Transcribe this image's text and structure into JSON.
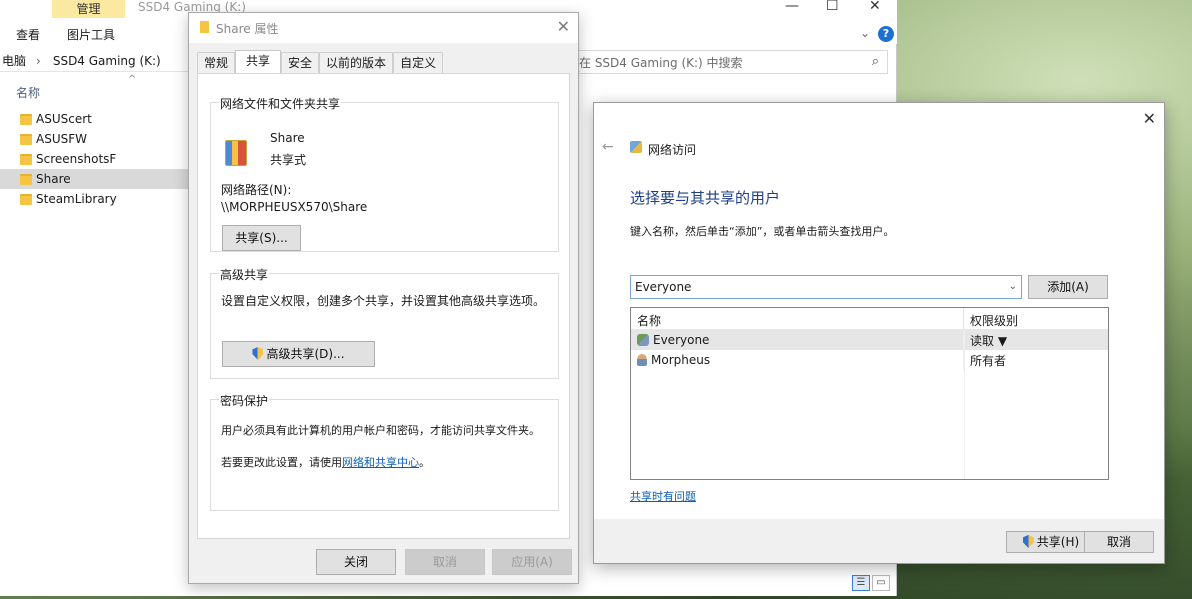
{
  "explorer": {
    "ribbon": {
      "context_tab": "管理",
      "window_title": "SSD4 Gaming (K:)",
      "tab_view": "查看",
      "tab_picture_tools": "图片工具"
    },
    "address": {
      "crumb_this_pc": "电脑",
      "crumb_drive": "SSD4 Gaming (K:)"
    },
    "search": {
      "placeholder": "在 SSD4 Gaming (K:) 中搜索"
    },
    "column_name": "名称",
    "files": [
      {
        "label": "ASUScert"
      },
      {
        "label": "ASUSFW"
      },
      {
        "label": "ScreenshotsF"
      },
      {
        "label": "Share"
      },
      {
        "label": "SteamLibrary"
      }
    ],
    "selected_index": 3
  },
  "properties": {
    "title": "Share 属性",
    "tabs": [
      "常规",
      "共享",
      "安全",
      "以前的版本",
      "自定义"
    ],
    "active_tab": "共享",
    "sharing": {
      "group_title": "网络文件和文件夹共享",
      "name": "Share",
      "state": "共享式",
      "path_label": "网络路径(N):",
      "path_value": "\\\\MORPHEUSX570\\Share",
      "share_button": "共享(S)..."
    },
    "advanced": {
      "group_title": "高级共享",
      "description": "设置自定义权限，创建多个共享，并设置其他高级共享选项。",
      "button": "高级共享(D)..."
    },
    "password": {
      "group_title": "密码保护",
      "line1": "用户必须具有此计算机的用户帐户和密码，才能访问共享文件夹。",
      "line2_prefix": "若要更改此设置，请使用",
      "line2_link": "网络和共享中心",
      "line2_suffix": "。"
    },
    "footer": {
      "close": "关闭",
      "cancel": "取消",
      "apply": "应用(A)"
    }
  },
  "network_access": {
    "title": "网络访问",
    "heading": "选择要与其共享的用户",
    "instruction": "键入名称，然后单击“添加”，或者单击箭头查找用户。",
    "input_value": "Everyone",
    "add_button": "添加(A)",
    "columns": {
      "name": "名称",
      "permission": "权限级别"
    },
    "rows": [
      {
        "name": "Everyone",
        "permission": "读取 ▼"
      },
      {
        "name": "Morpheus",
        "permission": "所有者"
      }
    ],
    "trouble_link": "共享时有问题",
    "share_button": "共享(H)",
    "cancel_button": "取消"
  }
}
